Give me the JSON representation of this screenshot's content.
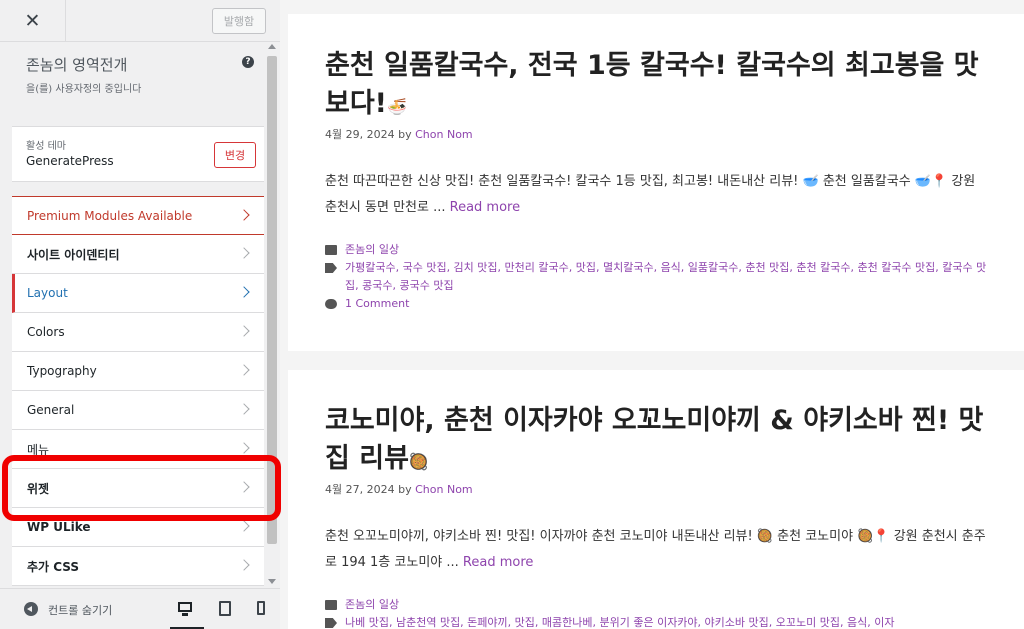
{
  "topbar": {
    "close": "✕",
    "publish": "발행함"
  },
  "site": {
    "title": "존놈의 영역전개",
    "subtitle": "을(를) 사용자정의 중입니다",
    "help": "?"
  },
  "theme": {
    "label": "활성 테마",
    "name": "GeneratePress",
    "change": "변경"
  },
  "menu": [
    {
      "label": "Premium Modules Available"
    },
    {
      "label": "사이트 아이덴티티"
    },
    {
      "label": "Layout"
    },
    {
      "label": "Colors"
    },
    {
      "label": "Typography"
    },
    {
      "label": "General"
    },
    {
      "label": "메뉴"
    },
    {
      "label": "위젯"
    },
    {
      "label": "WP ULike"
    },
    {
      "label": "추가 CSS"
    }
  ],
  "footer": {
    "hide": "컨트롤 숨기기"
  },
  "posts": [
    {
      "title": "춘천 일품칼국수, 전국 1등 칼국수! 칼국수의 최고봉을 맛보다!",
      "title_emoji": "🍜",
      "date": "4월 29, 2024",
      "by": "by",
      "author": "Chon Nom",
      "excerpt": "춘천 따끈따끈한 신상 맛집! 춘천 일품칼국수! 칼국수 1등 맛집, 최고봉! 내돈내산 리뷰! 🥣 춘천 일품칼국수 🥣📍 강원 춘천시 동면 만천로 ...",
      "read_more": "Read more",
      "category": "존놈의 일상",
      "tags": "가평칼국수, 국수 맛집, 김치 맛집, 만천리 칼국수, 맛집, 멸치칼국수, 음식, 일품칼국수, 춘천 맛집, 춘천 칼국수, 춘천 칼국수 맛집, 칼국수 맛집, 콩국수, 콩국수 맛집",
      "comments": "1 Comment"
    },
    {
      "title": "코노미야, 춘천 이자카야 오꼬노미야끼 & 야키소바 찐! 맛집 리뷰",
      "title_emoji": "🥘",
      "date": "4월 27, 2024",
      "by": "by",
      "author": "Chon Nom",
      "excerpt": "춘천 오꼬노미야끼, 야키소바 찐! 맛집! 이자까야 춘천 코노미야 내돈내산 리뷰! 🥘 춘천 코노미야 🥘📍 강원 춘천시 춘주로 194 1층 코노미야 ...",
      "read_more": "Read more",
      "category": "존놈의 일상",
      "tags": "나베 맛집, 남춘천역 맛집, 돈페야끼, 맛집, 매콤한나베, 분위기 좋은 이자카야, 야키소바 맛집, 오꼬노미 맛집, 음식, 이자"
    }
  ]
}
